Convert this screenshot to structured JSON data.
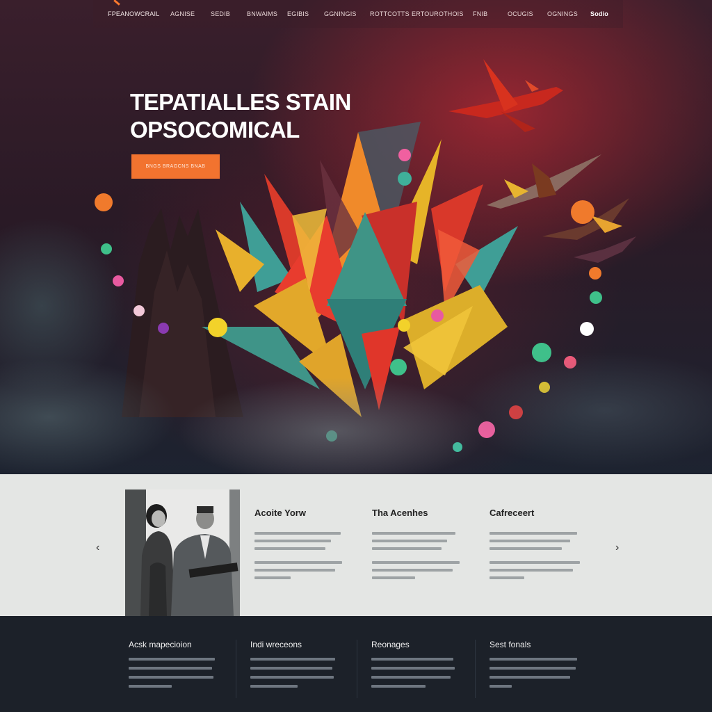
{
  "nav": {
    "brand": "FPEANOWCRAIL",
    "items": [
      "AGNISE",
      "SEDIB",
      "BNWAIMS",
      "EGIBIS",
      "GGNINGIS",
      "ROTTCOTTS",
      "ERTOUROTHOIS",
      "FNIB",
      "OCUGIS",
      "OGNINGS"
    ],
    "last": "Sodio"
  },
  "hero": {
    "title_line1": "TEPATIALLES STAIN",
    "title_line2": "OPSOCOMICAL",
    "cta_label": "BNGS BRAGCNS BNAB"
  },
  "features": {
    "prev_label": "‹",
    "next_label": "›",
    "columns": [
      {
        "title": "Acoite Yorw"
      },
      {
        "title": "Tha Acenhes"
      },
      {
        "title": "Cafreceert"
      }
    ]
  },
  "footer": {
    "columns": [
      {
        "title": "Acsk mapecioion"
      },
      {
        "title": "Indi wreceons"
      },
      {
        "title": "Reonages"
      },
      {
        "title": "Sest fonals"
      }
    ]
  },
  "colors": {
    "accent": "#f2732f",
    "hero_bg": "#2a1a26",
    "features_bg": "#e4e6e4",
    "footer_bg": "#1c2129"
  }
}
